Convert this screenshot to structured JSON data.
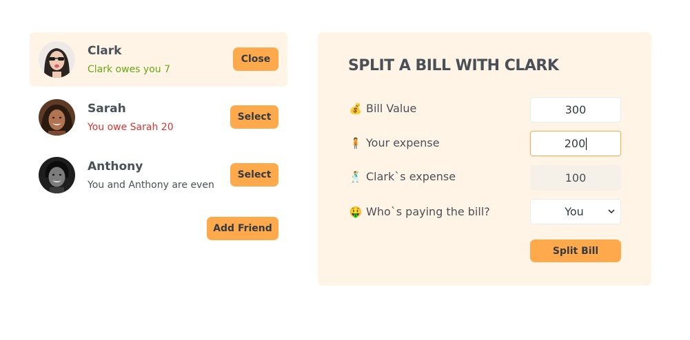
{
  "friends": [
    {
      "name": "Clark",
      "status": "Clark owes you 7",
      "status_type": "green",
      "button": "Close",
      "selected": true,
      "avatar": "woman-with-sunglasses-photo"
    },
    {
      "name": "Sarah",
      "status": "You owe Sarah 20",
      "status_type": "red",
      "button": "Select",
      "selected": false,
      "avatar": "smiling-woman-photo"
    },
    {
      "name": "Anthony",
      "status": "You and Anthony are even",
      "status_type": "neutral",
      "button": "Select",
      "selected": false,
      "avatar": "smiling-man-bw-photo"
    }
  ],
  "add_friend_label": "Add Friend",
  "form": {
    "title": "SPLIT A BILL WITH CLARK",
    "bill_value": {
      "emoji": "💰",
      "label": "Bill Value",
      "value": "300"
    },
    "your_expense": {
      "emoji": "🧍",
      "label": "Your expense",
      "value": "200"
    },
    "friend_expense": {
      "emoji": "🕺",
      "label": "Clark`s expense",
      "value": "100"
    },
    "payer": {
      "emoji": "🤑",
      "label": "Who`s paying the bill?",
      "selected": "You"
    },
    "submit_label": "Split Bill"
  },
  "colors": {
    "accent": "#ffa94d",
    "panel_bg": "#fff4e6",
    "owes_you": "#66a80f",
    "you_owe": "#e03131",
    "text": "#495057"
  }
}
